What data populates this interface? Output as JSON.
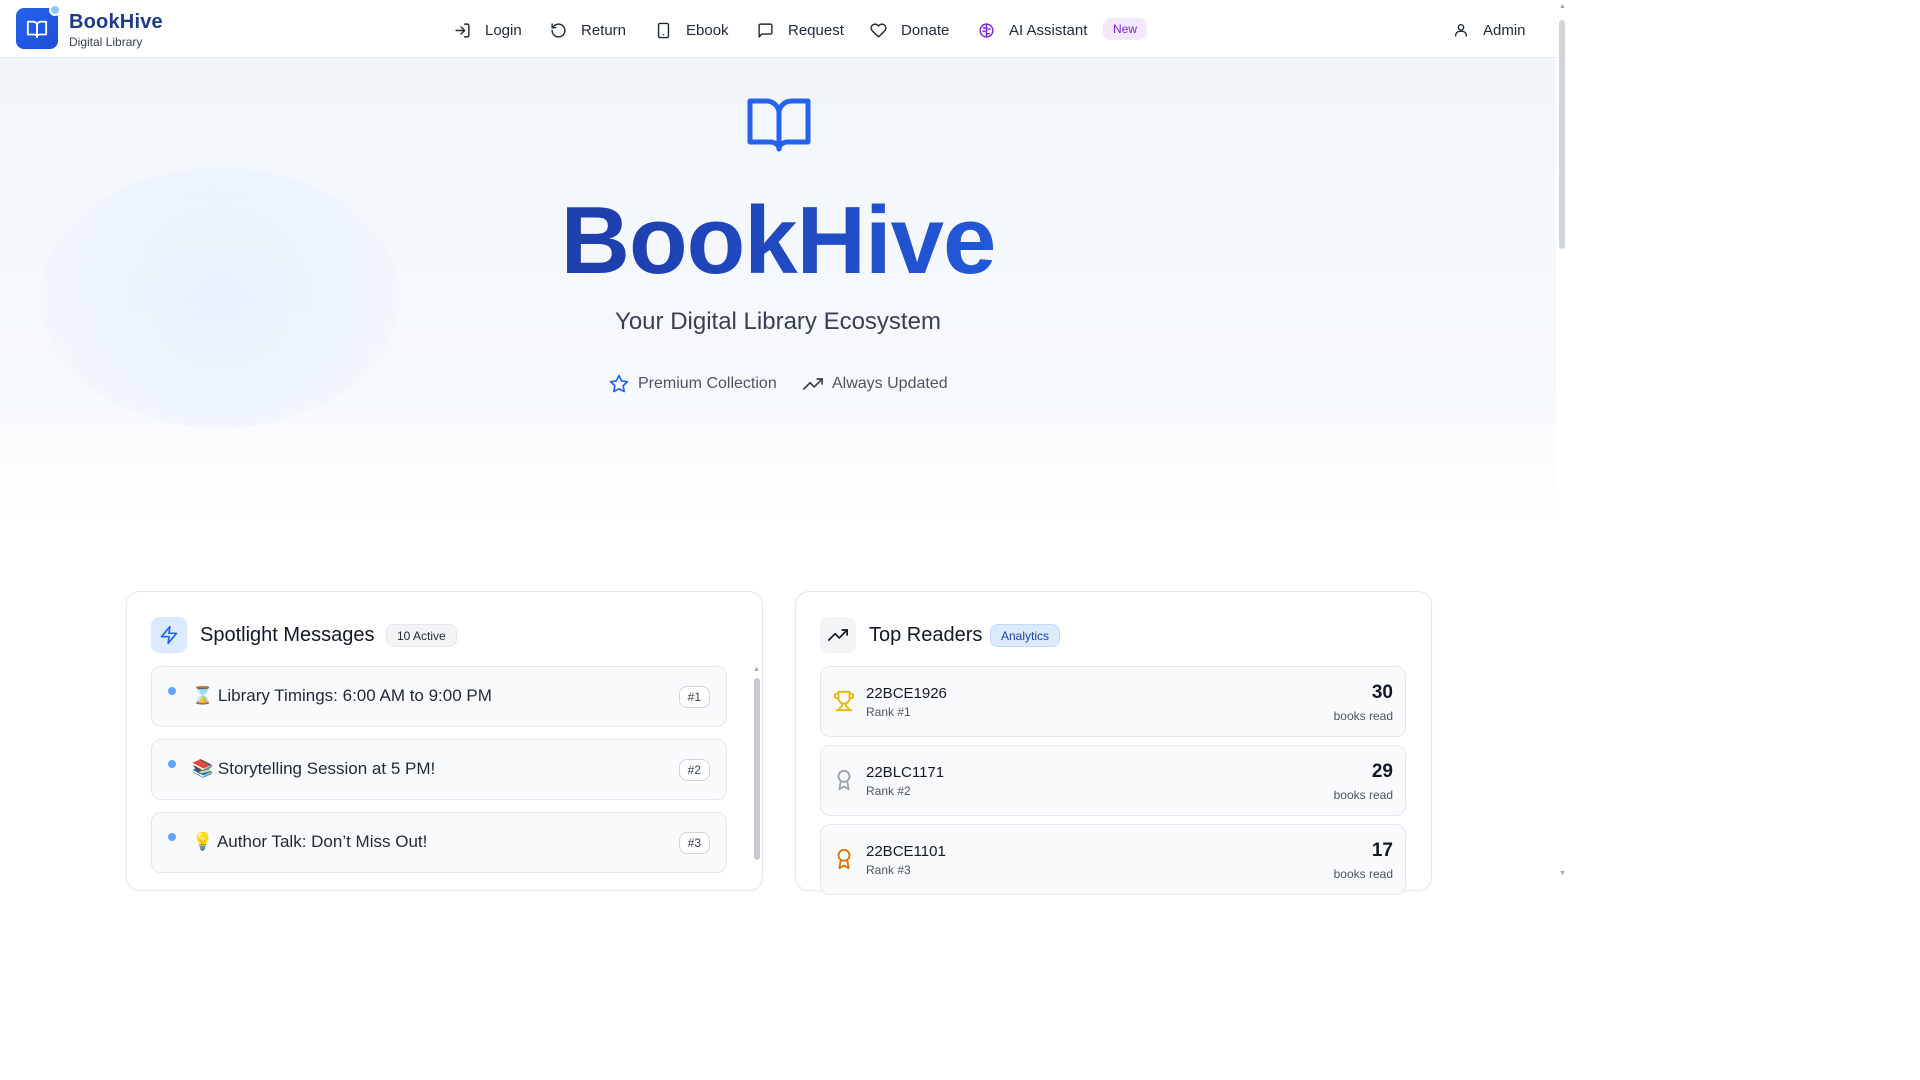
{
  "navbar": {
    "brand_name": "BookHive",
    "brand_sub": "Digital Library",
    "items": [
      {
        "label": "Login",
        "icon": "login-icon"
      },
      {
        "label": "Return",
        "icon": "return-icon"
      },
      {
        "label": "Ebook",
        "icon": "tablet-icon"
      },
      {
        "label": "Request",
        "icon": "message-icon"
      },
      {
        "label": "Donate",
        "icon": "heart-icon"
      },
      {
        "label": "AI Assistant",
        "icon": "brain-icon"
      }
    ],
    "new_badge": "New",
    "admin_label": "Admin",
    "accent_color": "#2563eb",
    "ai_color": "#7e22ce"
  },
  "hero": {
    "title": "BookHive",
    "subtitle": "Your Digital Library Ecosystem",
    "features": [
      {
        "label": "Premium Collection",
        "icon": "star-icon"
      },
      {
        "label": "Always Updated",
        "icon": "trending-up-icon"
      }
    ]
  },
  "spotlight": {
    "title": "Spotlight Messages",
    "badge": "10 Active",
    "icon": "lightning-icon",
    "messages": [
      {
        "emoji": "⌛",
        "text": "Library Timings: 6:00 AM to 9:00 PM",
        "num": "#1"
      },
      {
        "emoji": "📚",
        "text": "Storytelling Session at 5 PM!",
        "num": "#2"
      },
      {
        "emoji": "💡",
        "text": "Author Talk: Don’t Miss Out!",
        "num": "#3"
      }
    ]
  },
  "top_readers": {
    "title": "Top Readers",
    "badge": "Analytics",
    "icon": "trending-up-icon",
    "readers": [
      {
        "id": "22BCE1926",
        "rank": "Rank #1",
        "count": "30",
        "unit": "books read",
        "icon": "trophy-icon",
        "color": "#eab308"
      },
      {
        "id": "22BLC1171",
        "rank": "Rank #2",
        "count": "29",
        "unit": "books read",
        "icon": "medal-icon",
        "color": "#9ca3af"
      },
      {
        "id": "22BCE1101",
        "rank": "Rank #3",
        "count": "17",
        "unit": "books read",
        "icon": "award-icon",
        "color": "#d97706"
      }
    ]
  }
}
